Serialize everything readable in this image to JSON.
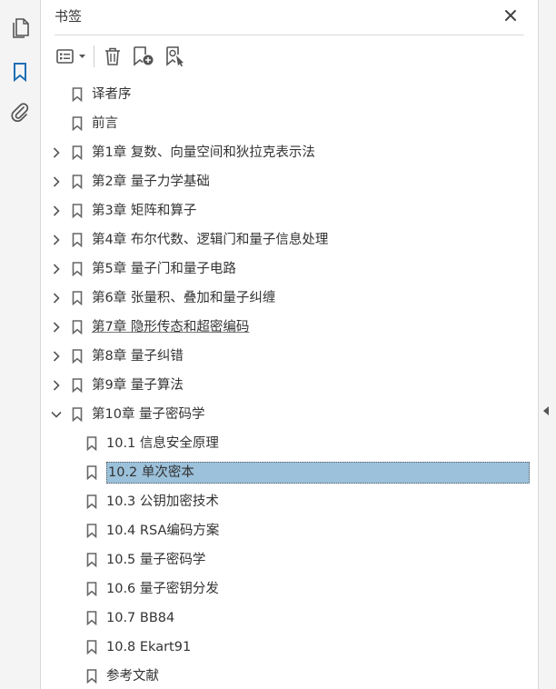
{
  "panel": {
    "title": "书签"
  },
  "toolbar": {
    "options": "options-icon",
    "delete": "trash-icon",
    "new_bookmark": "add-bookmark-icon",
    "find_bookmark": "find-bookmark-icon"
  },
  "bookmarks": [
    {
      "label": "译者序",
      "level": 0,
      "expander": "none"
    },
    {
      "label": "前言",
      "level": 0,
      "expander": "none"
    },
    {
      "label": "第1章 复数、向量空间和狄拉克表示法",
      "level": 0,
      "expander": "collapsed"
    },
    {
      "label": "第2章 量子力学基础",
      "level": 0,
      "expander": "collapsed"
    },
    {
      "label": "第3章 矩阵和算子",
      "level": 0,
      "expander": "collapsed"
    },
    {
      "label": "第4章 布尔代数、逻辑门和量子信息处理",
      "level": 0,
      "expander": "collapsed"
    },
    {
      "label": "第5章 量子门和量子电路",
      "level": 0,
      "expander": "collapsed"
    },
    {
      "label": "第6章 张量积、叠加和量子纠缠",
      "level": 0,
      "expander": "collapsed"
    },
    {
      "label": "第7章 隐形传态和超密编码",
      "level": 0,
      "expander": "collapsed"
    },
    {
      "label": "第8章 量子纠错",
      "level": 0,
      "expander": "collapsed"
    },
    {
      "label": "第9章 量子算法",
      "level": 0,
      "expander": "collapsed"
    },
    {
      "label": "第10章 量子密码学",
      "level": 0,
      "expander": "expanded"
    },
    {
      "label": "10.1 信息安全原理",
      "level": 1,
      "expander": "none"
    },
    {
      "label": "10.2 单次密本",
      "level": 1,
      "expander": "none"
    },
    {
      "label": "10.3 公钥加密技术",
      "level": 1,
      "expander": "none"
    },
    {
      "label": "10.4 RSA编码方案",
      "level": 1,
      "expander": "none"
    },
    {
      "label": "10.5 量子密码学",
      "level": 1,
      "expander": "none"
    },
    {
      "label": "10.6 量子密钥分发",
      "level": 1,
      "expander": "none"
    },
    {
      "label": "10.7 BB84",
      "level": 1,
      "expander": "none"
    },
    {
      "label": "10.8 Ekart91",
      "level": 1,
      "expander": "none"
    },
    {
      "label": "参考文献",
      "level": 1,
      "expander": "none"
    }
  ],
  "selected_index": 13,
  "hover_index": 8,
  "colors": {
    "accent": "#1f6fb5",
    "selection": "#9bc1db",
    "icon": "#555555"
  }
}
